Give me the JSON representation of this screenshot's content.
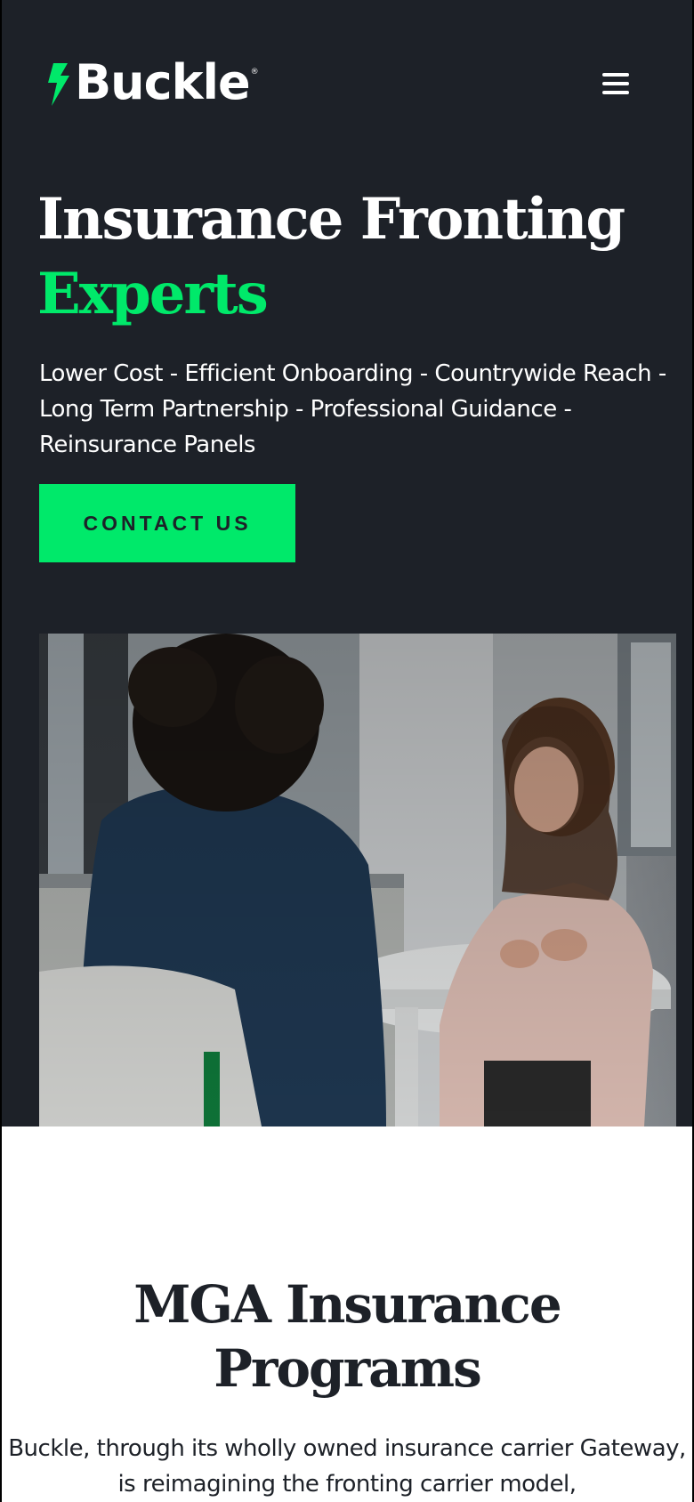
{
  "header": {
    "logo_text": "Buckle",
    "logo_registered": "®",
    "menu_icon": "hamburger-menu-icon"
  },
  "hero": {
    "title_line1": "Insurance Fronting",
    "title_line2": "Experts",
    "subtitle": "Lower Cost - Efficient Onboarding - Countrywide Reach - Long Term Partnership - Professional Guidance - Reinsurance Panels",
    "cta_label": "CONTACT US"
  },
  "colors": {
    "hero_bg": "#1d2128",
    "accent": "#00e96a",
    "text_light": "#ffffff",
    "text_dark": "#1d2128"
  },
  "section": {
    "title_line1": "MGA Insurance",
    "title_line2": "Programs",
    "body": "Buckle, through its wholly owned insurance carrier Gateway, is reimagining the fronting carrier model,"
  }
}
